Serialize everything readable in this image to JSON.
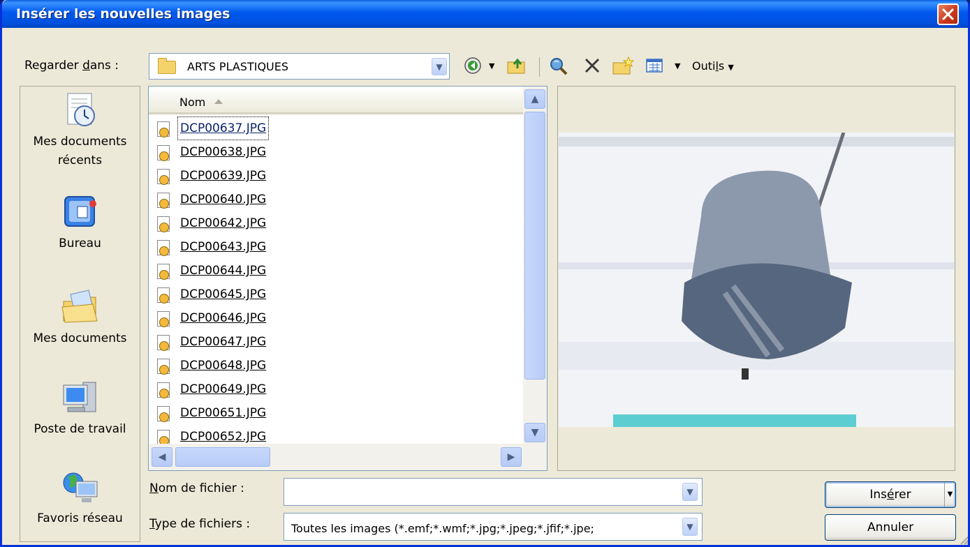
{
  "window": {
    "title": "Insérer les nouvelles images"
  },
  "lookin": {
    "label_pre": "Regarder ",
    "label_u": "d",
    "label_post": "ans :",
    "value": "ARTS PLASTIQUES"
  },
  "toolbar": {
    "tools_pre": "Outi",
    "tools_u": "l",
    "tools_post": "s"
  },
  "places": [
    {
      "line1": "Mes documents",
      "line2": "récents",
      "icon": "recent-documents-icon"
    },
    {
      "line1": "Bureau",
      "line2": "",
      "icon": "desktop-icon"
    },
    {
      "line1": "Mes documents",
      "line2": "",
      "icon": "my-documents-icon"
    },
    {
      "line1": "Poste de travail",
      "line2": "",
      "icon": "my-computer-icon"
    },
    {
      "line1": "Favoris réseau",
      "line2": "",
      "icon": "network-places-icon"
    }
  ],
  "list": {
    "column": "Nom",
    "files": [
      "DCP00637.JPG",
      "DCP00638.JPG",
      "DCP00639.JPG",
      "DCP00640.JPG",
      "DCP00642.JPG",
      "DCP00643.JPG",
      "DCP00644.JPG",
      "DCP00645.JPG",
      "DCP00646.JPG",
      "DCP00647.JPG",
      "DCP00648.JPG",
      "DCP00649.JPG",
      "DCP00651.JPG",
      "DCP00652.JPG"
    ],
    "selected_index": 0,
    "scroll_position": 0
  },
  "filename": {
    "label_u": "N",
    "label_rest": "om de fichier :",
    "value": ""
  },
  "filetype": {
    "label_u": "T",
    "label_rest": "ype de fichiers :",
    "value": "Toutes les images (*.emf;*.wmf;*.jpg;*.jpeg;*.jfif;*.jpe;"
  },
  "buttons": {
    "insert_pre": "Ins",
    "insert_u": "é",
    "insert_post": "rer",
    "cancel": "Annuler"
  },
  "colors": {
    "title_bar": "#0058ee",
    "dialog_bg": "#ece9d8",
    "close": "#c8351a"
  }
}
